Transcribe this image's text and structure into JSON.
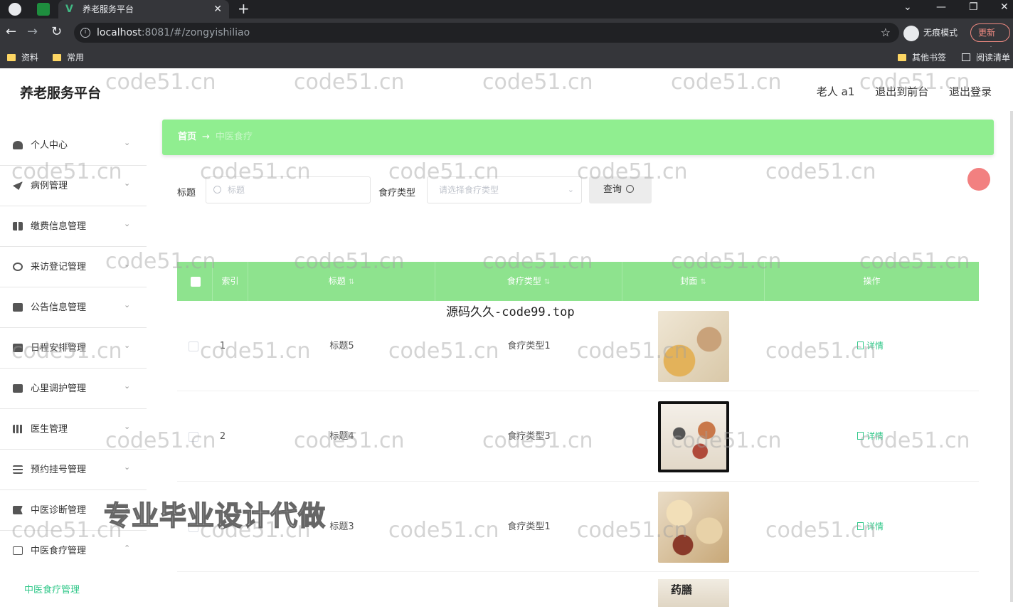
{
  "browser": {
    "tab_title": "养老服务平台",
    "tab_close": "✕",
    "new_tab": "+",
    "window_controls": [
      "⌄",
      "—",
      "❐",
      "✕"
    ],
    "url_host": "localhost",
    "url_path": ":8081/#/zongyishiliao",
    "incognito_label": "无痕模式",
    "update_label": "更新",
    "menu_dots": "⋮",
    "bookmarks_left": [
      "资料",
      "常用"
    ],
    "bookmarks_right": [
      "其他书签",
      "阅读清单"
    ]
  },
  "header": {
    "brand": "养老服务平台",
    "user": "老人 a1",
    "links": [
      "退出到前台",
      "退出登录"
    ]
  },
  "sidebar": {
    "items": [
      {
        "label": "个人中心",
        "arrow": "⌄"
      },
      {
        "label": "病例管理",
        "arrow": "⌄"
      },
      {
        "label": "缴费信息管理",
        "arrow": "⌄"
      },
      {
        "label": "来访登记管理",
        "arrow": "⌄"
      },
      {
        "label": "公告信息管理",
        "arrow": "⌄"
      },
      {
        "label": "日程安排管理",
        "arrow": "⌄"
      },
      {
        "label": "心里调护管理",
        "arrow": "⌄"
      },
      {
        "label": "医生管理",
        "arrow": "⌄"
      },
      {
        "label": "预约挂号管理",
        "arrow": "⌄"
      },
      {
        "label": "中医诊断管理",
        "arrow": "⌄"
      },
      {
        "label": "中医食疗管理",
        "arrow": "⌃"
      }
    ],
    "sub_item": "中医食疗管理"
  },
  "breadcrumb": {
    "home": "首页",
    "separator": "→",
    "current": "中医食疗"
  },
  "filters": {
    "title_label": "标题",
    "title_placeholder": "标题",
    "type_label": "食疗类型",
    "type_placeholder": "请选择食疗类型",
    "query_button": "查询"
  },
  "table": {
    "columns": [
      "索引",
      "标题",
      "食疗类型",
      "封面",
      "操作"
    ],
    "rows": [
      {
        "index": "1",
        "title": "标题5",
        "type": "食疗类型1",
        "action": "详情"
      },
      {
        "index": "2",
        "title": "标题4",
        "type": "食疗类型3",
        "action": "详情"
      },
      {
        "index": "3",
        "title": "标题3",
        "type": "食疗类型1",
        "action": "详情"
      }
    ],
    "partial_row_cover_text": "药膳"
  },
  "overlays": {
    "watermark": "code51.cn",
    "source_text": "源码久久-code99.top",
    "ad_text": "专业毕业设计代做"
  },
  "colors": {
    "accent_green": "#90ee90",
    "table_header_green": "#8ee38e",
    "link_green": "#32c88a"
  }
}
